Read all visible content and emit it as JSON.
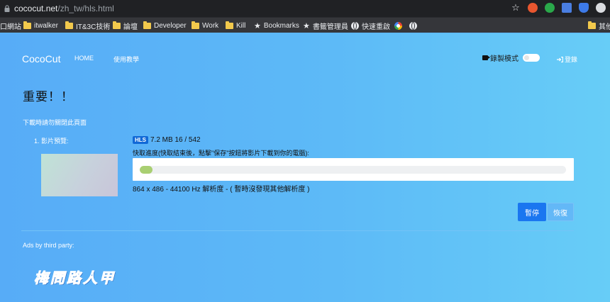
{
  "browser": {
    "url_host": "cococut.net",
    "url_path": "/zh_tw/hls.html",
    "bookmarks": [
      {
        "label": "口網站",
        "icon": "none"
      },
      {
        "label": "itwalker",
        "icon": "folder-icon"
      },
      {
        "label": "IT&3C技術",
        "icon": "folder-icon"
      },
      {
        "label": "論壇",
        "icon": "folder-icon"
      },
      {
        "label": "Developer",
        "icon": "folder-icon"
      },
      {
        "label": "Work",
        "icon": "folder-icon"
      },
      {
        "label": "Kill",
        "icon": "folder-icon"
      },
      {
        "label": "Bookmarks",
        "icon": "star-icon"
      },
      {
        "label": "書籤管理員",
        "icon": "star-icon"
      },
      {
        "label": "快速重啟",
        "icon": "globe-icon"
      },
      {
        "label": "",
        "icon": "google-icon"
      },
      {
        "label": "",
        "icon": "globe-icon"
      },
      {
        "label": "其他",
        "icon": "folder-icon"
      }
    ]
  },
  "nav": {
    "brand": "CocoCut",
    "home": "HOME",
    "tutorial": "使用教學",
    "record_mode": "錄製模式",
    "login": "登錄"
  },
  "main": {
    "heading": "重要！！",
    "notice": "下載時請勿關閉此頁面",
    "item_label": "1. 影片預覽:",
    "badge": "HLS",
    "stats": "7.2 MB 16 / 542",
    "progress_hint": "快取進度(快取結束後，點擊\"保存\"按鈕將影片下載到你的電腦):",
    "progress": 0.03,
    "resolution": "864 x 486 - 44100 Hz 解析度 - ( 暫時沒發現其他解析度 )",
    "pause_label": "暫停",
    "resume_label": "恢復",
    "ads_label": "Ads by third party:",
    "watermark": "梅問路人甲"
  },
  "colors": {
    "accent": "#1a76f0",
    "progress_fill": "#a9cf72",
    "badge": "#1168d6"
  }
}
